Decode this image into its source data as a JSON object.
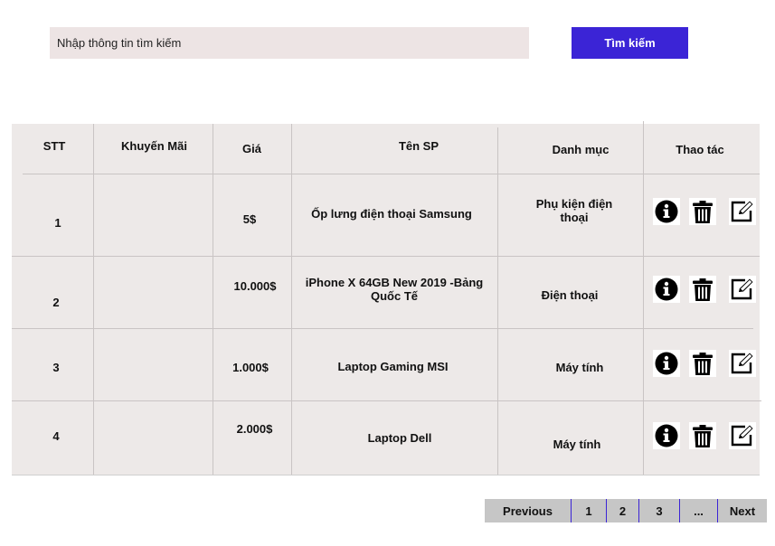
{
  "search": {
    "placeholder": "Nhập thông tin tìm kiếm",
    "button_label": "Tìm kiếm"
  },
  "table": {
    "headers": {
      "stt": "STT",
      "promo": "Khuyến Mãi",
      "price": "Giá",
      "name": "Tên SP",
      "category": "Danh mục",
      "actions": "Thao tác"
    },
    "rows": [
      {
        "stt": "1",
        "promo": "",
        "price": "5$",
        "name": "Ốp lưng điện thoại Samsung",
        "category": "Phụ kiện điện thoại"
      },
      {
        "stt": "2",
        "promo": "",
        "price": "10.000$",
        "name": "iPhone X 64GB New 2019 -Bảng Quốc Tế",
        "category": "Điện thoại"
      },
      {
        "stt": "3",
        "promo": "",
        "price": "1.000$",
        "name": "Laptop Gaming MSI",
        "category": "Máy tính"
      },
      {
        "stt": "4",
        "promo": "",
        "price": "2.000$",
        "name": "Laptop Dell",
        "category": "Máy tính"
      }
    ],
    "action_icons": [
      "info-icon",
      "trash-icon",
      "edit-icon"
    ]
  },
  "pagination": {
    "previous": "Previous",
    "pages": [
      "1",
      "2",
      "3",
      "..."
    ],
    "next": "Next"
  },
  "colors": {
    "accent": "#3b24d6",
    "search_bg": "#ede4e4",
    "table_bg": "#ede9e8",
    "pager_bg": "#c6c6c6"
  }
}
